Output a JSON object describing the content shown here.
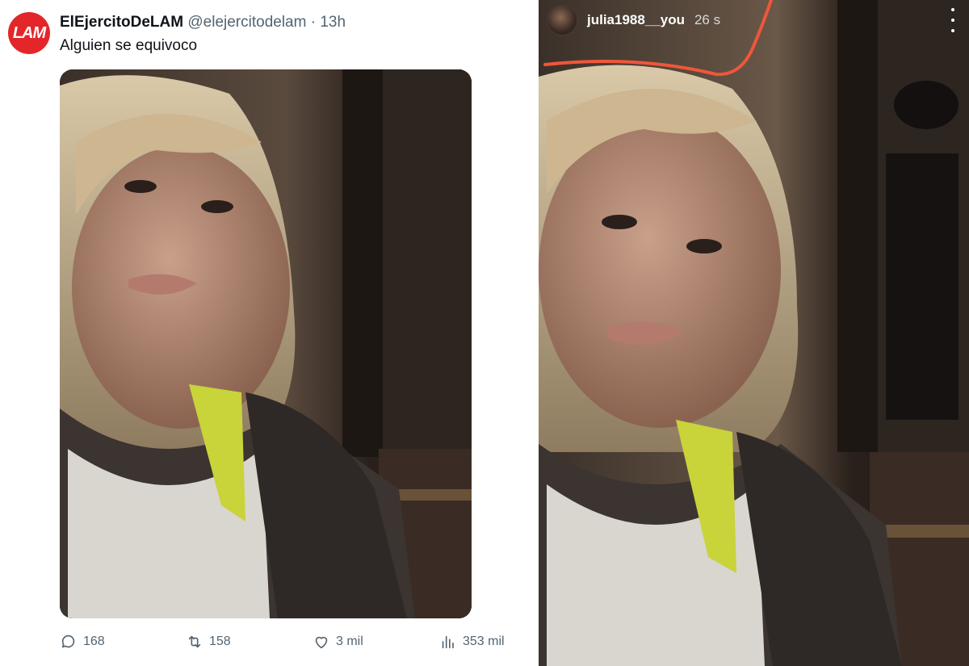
{
  "tweet": {
    "avatar_text": "LAM",
    "display_name": "ElEjercitoDeLAM",
    "handle": "@elejercitodelam",
    "separator": "·",
    "time": "13h",
    "text": "Alguien se equivoco",
    "actions": {
      "replies": "168",
      "retweets": "158",
      "likes": "3 mil",
      "views": "353 mil"
    }
  },
  "story": {
    "username": "julia1988__you",
    "time": "26 s",
    "annotation_color": "#f0563a"
  },
  "colors": {
    "avatar_red": "#e3262a",
    "text_primary": "#0f1419",
    "text_secondary": "#536471"
  }
}
